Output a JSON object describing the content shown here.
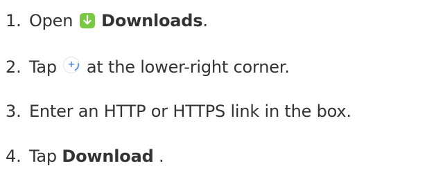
{
  "icons": {
    "downloads_app": "download-arrow-icon",
    "add_button": "plus-icon"
  },
  "colors": {
    "text": "#333333",
    "downloads_icon_bg": "#7ac943",
    "plus_icon_ring": "#3a7bd5"
  },
  "steps": [
    {
      "number": "1.",
      "before": "Open",
      "bold": "Downloads",
      "after": "."
    },
    {
      "number": "2.",
      "before": "Tap",
      "after": "at the lower-right corner."
    },
    {
      "number": "3.",
      "text": "Enter an HTTP or HTTPS link in the box."
    },
    {
      "number": "4.",
      "before": "Tap",
      "bold": "Download",
      "after": " ."
    }
  ]
}
